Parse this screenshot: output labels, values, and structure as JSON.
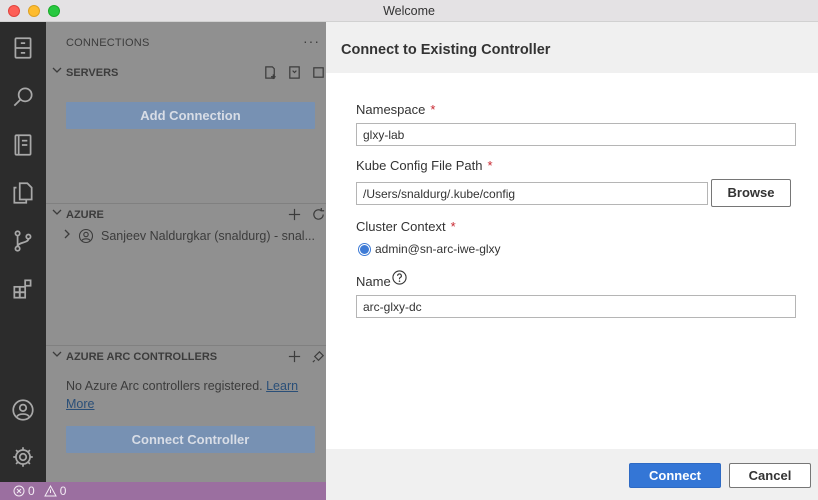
{
  "window": {
    "title": "Welcome"
  },
  "activity_bar": {
    "items": [
      {
        "icon": "file-cabinet-icon"
      },
      {
        "icon": "search-icon"
      },
      {
        "icon": "notebook-icon"
      },
      {
        "icon": "explorer-icon"
      },
      {
        "icon": "source-control-icon"
      },
      {
        "icon": "extensions-icon"
      },
      {
        "icon": "account-icon"
      },
      {
        "icon": "gear-icon"
      }
    ]
  },
  "sidebar": {
    "header": "CONNECTIONS",
    "more": "···",
    "servers": {
      "title": "SERVERS",
      "add_button": "Add Connection"
    },
    "azure": {
      "title": "AZURE",
      "account": "Sanjeev Naldurgkar (snaldurg) - snal..."
    },
    "arc": {
      "title": "AZURE ARC CONTROLLERS",
      "empty_text": "No Azure Arc controllers registered.",
      "learn_more": "Learn More",
      "connect_button": "Connect Controller"
    }
  },
  "status_bar": {
    "errors": "0",
    "warnings": "0"
  },
  "dialog": {
    "title": "Connect to Existing Controller",
    "namespace": {
      "label": "Namespace",
      "required": "*",
      "value": "glxy-lab"
    },
    "kube_config": {
      "label": "Kube Config File Path",
      "required": "*",
      "value": "/Users/snaldurg/.kube/config",
      "browse": "Browse"
    },
    "cluster_context": {
      "label": "Cluster Context",
      "required": "*",
      "selected": "admin@sn-arc-iwe-glxy"
    },
    "name": {
      "label": "Name",
      "value": "arc-glxy-dc"
    },
    "buttons": {
      "connect": "Connect",
      "cancel": "Cancel"
    }
  },
  "colors": {
    "accent": "#3476d6",
    "status_bar": "#9b6fa0",
    "required": "#c8262f"
  }
}
